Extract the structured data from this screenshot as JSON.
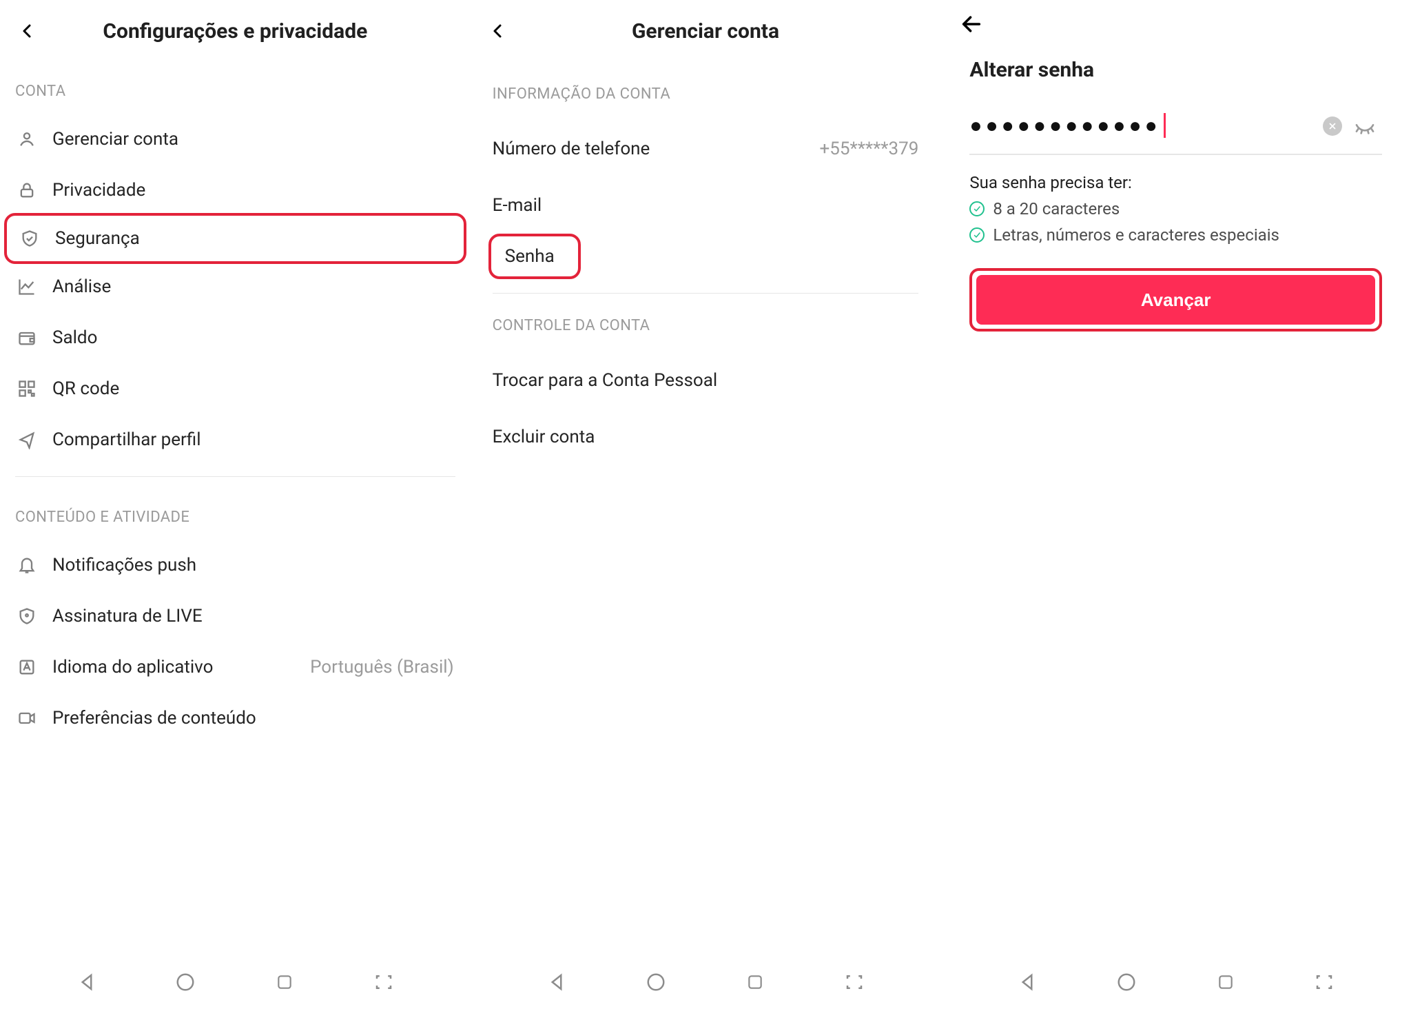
{
  "panel1": {
    "title": "Configurações e privacidade",
    "sectionAccount": "CONTA",
    "items": {
      "manage": "Gerenciar conta",
      "privacy": "Privacidade",
      "security": "Segurança",
      "analytics": "Análise",
      "balance": "Saldo",
      "qrcode": "QR code",
      "share": "Compartilhar perfil"
    },
    "sectionContent": "CONTEÚDO E ATIVIDADE",
    "items2": {
      "push": "Notificações push",
      "live": "Assinatura de LIVE",
      "lang": "Idioma do aplicativo",
      "lang_value": "Português (Brasil)",
      "pref": "Preferências de conteúdo"
    }
  },
  "panel2": {
    "title": "Gerenciar conta",
    "sectionInfo": "INFORMAÇÃO DA CONTA",
    "rows": {
      "phone_label": "Número de telefone",
      "phone_value": "+55*****379",
      "email_label": "E-mail",
      "password_label": "Senha"
    },
    "sectionControl": "CONTROLE DA CONTA",
    "rows2": {
      "switch": "Trocar para a Conta Pessoal",
      "delete": "Excluir conta"
    }
  },
  "panel3": {
    "title": "Alterar senha",
    "password_mask": "●●●●●●●●●●●●",
    "req_title": "Sua senha precisa ter:",
    "req1": "8 a 20 caracteres",
    "req2": "Letras, números e caracteres especiais",
    "advance": "Avançar"
  }
}
